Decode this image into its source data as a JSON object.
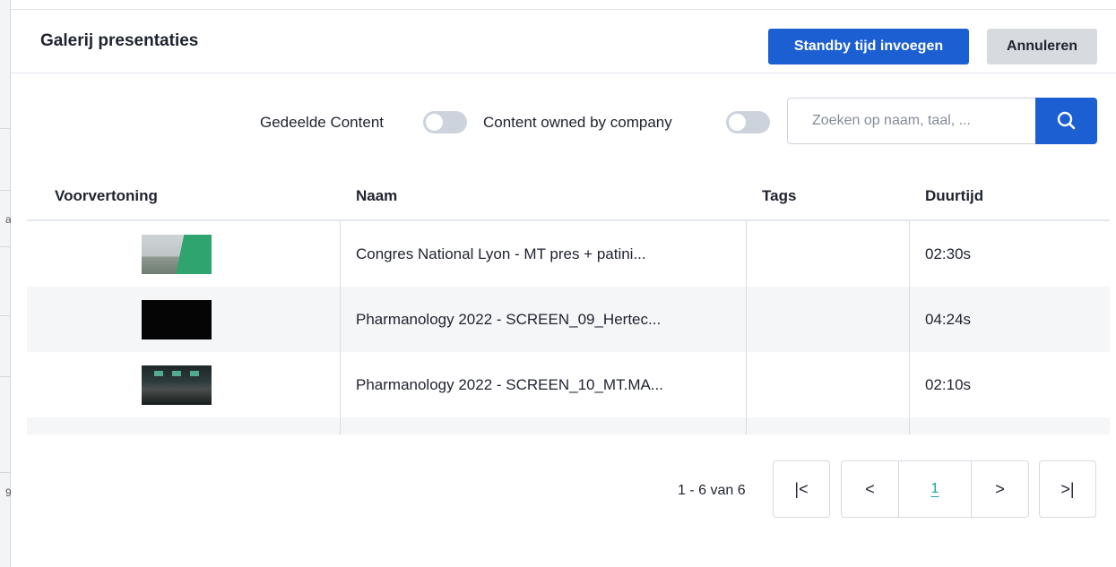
{
  "backdrop": {
    "fragments": [
      "a",
      "9"
    ]
  },
  "header": {
    "title": "Galerij presentaties",
    "primary_button": "Standby tijd invoegen",
    "secondary_button": "Annuleren"
  },
  "filters": {
    "shared_label": "Gedeelde Content",
    "owned_label": "Content owned by company",
    "search_placeholder": "Zoeken op naam, taal, ..."
  },
  "table": {
    "columns": [
      "Voorvertoning",
      "Naam",
      "Tags",
      "Duurtijd"
    ],
    "rows": [
      {
        "name": "Congres National Lyon - MT pres + patini...",
        "tags": "",
        "duration": "02:30s"
      },
      {
        "name": "Pharmanology 2022 - SCREEN_09_Hertec...",
        "tags": "",
        "duration": "04:24s"
      },
      {
        "name": "Pharmanology 2022 - SCREEN_10_MT.MA...",
        "tags": "",
        "duration": "02:10s"
      }
    ]
  },
  "pagination": {
    "info": "1 - 6 van 6",
    "first": "|<",
    "prev": "<",
    "current": "1",
    "next": ">",
    "last": ">|"
  },
  "colors": {
    "primary": "#1c5fd2",
    "accent": "#1aa79a",
    "toggle_off": "#cdd3dc"
  }
}
